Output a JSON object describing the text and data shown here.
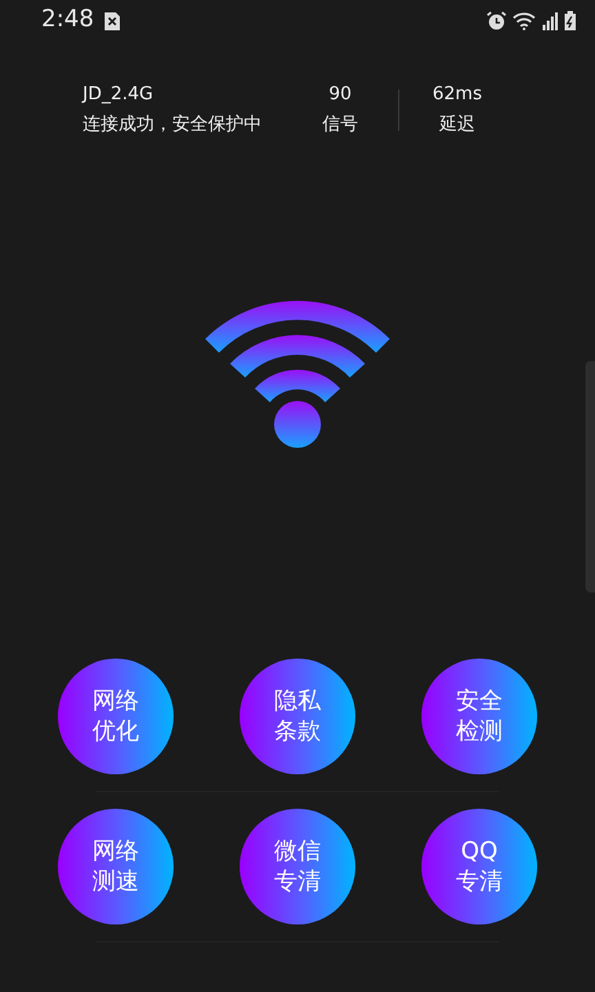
{
  "status_bar": {
    "time": "2:48"
  },
  "network": {
    "ssid": "JD_2.4G",
    "status": "连接成功，安全保护中",
    "signal_value": "90",
    "signal_label": "信号",
    "latency_value": "62ms",
    "latency_label": "延迟"
  },
  "actions": [
    {
      "lines": [
        "网络",
        "优化"
      ]
    },
    {
      "lines": [
        "隐私",
        "条款"
      ]
    },
    {
      "lines": [
        "安全",
        "检测"
      ]
    },
    {
      "lines": [
        "网络",
        "测速"
      ]
    },
    {
      "lines": [
        "微信",
        "专清"
      ]
    },
    {
      "lines": [
        "QQ",
        "专清"
      ]
    }
  ]
}
